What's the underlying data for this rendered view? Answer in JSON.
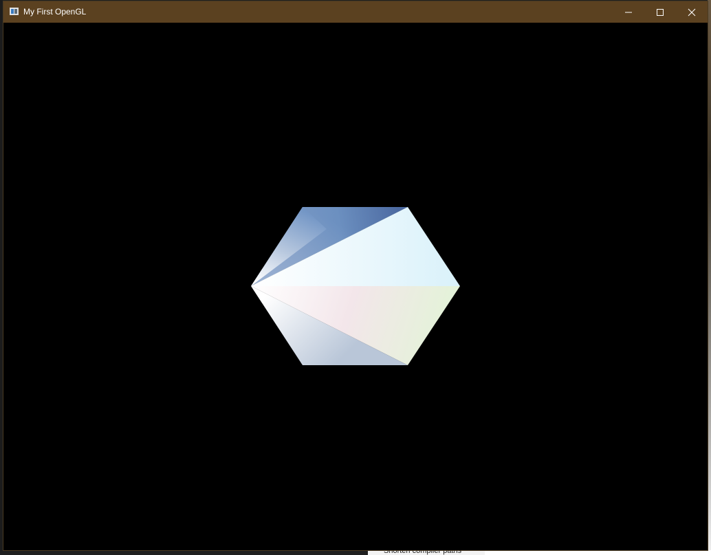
{
  "window": {
    "title": "My First OpenGL",
    "titlebar_color": "#5b4120",
    "client_background": "#000000",
    "controls": {
      "minimize_icon": "minimize-icon",
      "maximize_icon": "maximize-icon",
      "close_icon": "close-icon"
    }
  },
  "background": {
    "visible_text": "Shorten compiler paths"
  },
  "scene": {
    "shape": "hexagon",
    "triangle_count": 4,
    "colors": {
      "top_left_blue": "#4f76aa",
      "dark_blue": "#3a5590",
      "white_center": "#ffffff",
      "light_cyan": "#d9f1fa",
      "light_pink": "#f4dfe6",
      "light_green": "#e3f3d8",
      "bottom_gray_blue": "#b9c6d8"
    }
  }
}
